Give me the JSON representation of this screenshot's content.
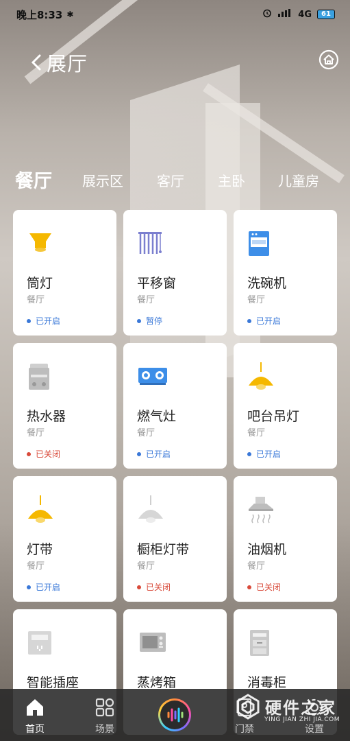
{
  "status_bar": {
    "time": "晚上8:33",
    "bluetooth": "✱",
    "signal": "4G",
    "battery": "61"
  },
  "header": {
    "title": "展厅"
  },
  "tabs": [
    {
      "label": "餐厅",
      "active": true
    },
    {
      "label": "展示区",
      "active": false
    },
    {
      "label": "客厅",
      "active": false
    },
    {
      "label": "主卧",
      "active": false
    },
    {
      "label": "儿童房",
      "active": false
    }
  ],
  "devices": [
    {
      "name": "筒灯",
      "room": "餐厅",
      "status": "已开启",
      "state": "on",
      "icon": "downlight-icon"
    },
    {
      "name": "平移窗",
      "room": "餐厅",
      "status": "暂停",
      "state": "on",
      "icon": "curtain-icon"
    },
    {
      "name": "洗碗机",
      "room": "餐厅",
      "status": "已开启",
      "state": "on",
      "icon": "dishwasher-icon"
    },
    {
      "name": "热水器",
      "room": "餐厅",
      "status": "已关闭",
      "state": "off",
      "icon": "water-heater-icon"
    },
    {
      "name": "燃气灶",
      "room": "餐厅",
      "status": "已开启",
      "state": "on",
      "icon": "gas-stove-icon"
    },
    {
      "name": "吧台吊灯",
      "room": "餐厅",
      "status": "已开启",
      "state": "on",
      "icon": "pendant-lamp-icon"
    },
    {
      "name": "灯带",
      "room": "餐厅",
      "status": "已开启",
      "state": "on",
      "icon": "pendant-lamp-icon"
    },
    {
      "name": "橱柜灯带",
      "room": "餐厅",
      "status": "已关闭",
      "state": "off",
      "icon": "pendant-lamp-gray-icon"
    },
    {
      "name": "油烟机",
      "room": "餐厅",
      "status": "已关闭",
      "state": "off",
      "icon": "range-hood-icon"
    },
    {
      "name": "智能插座",
      "room": "",
      "status": "",
      "state": "",
      "icon": "smart-socket-icon"
    },
    {
      "name": "蒸烤箱",
      "room": "",
      "status": "",
      "state": "",
      "icon": "oven-icon"
    },
    {
      "name": "消毒柜",
      "room": "",
      "status": "",
      "state": "",
      "icon": "sterilizer-icon"
    }
  ],
  "colors": {
    "on": "#3a78d8",
    "off": "#d94a3a",
    "accent_yellow": "#f5b800"
  },
  "nav": [
    {
      "label": "首页",
      "icon": "home-icon",
      "active": true
    },
    {
      "label": "场景",
      "icon": "scene-grid-icon",
      "active": false
    },
    {
      "label": "门禁",
      "icon": "door-access-icon",
      "active": false
    },
    {
      "label": "设置",
      "icon": "settings-icon",
      "active": false
    }
  ],
  "watermark": {
    "text": "硬件之家",
    "sub": "YING JIAN ZHI JIA.COM"
  }
}
